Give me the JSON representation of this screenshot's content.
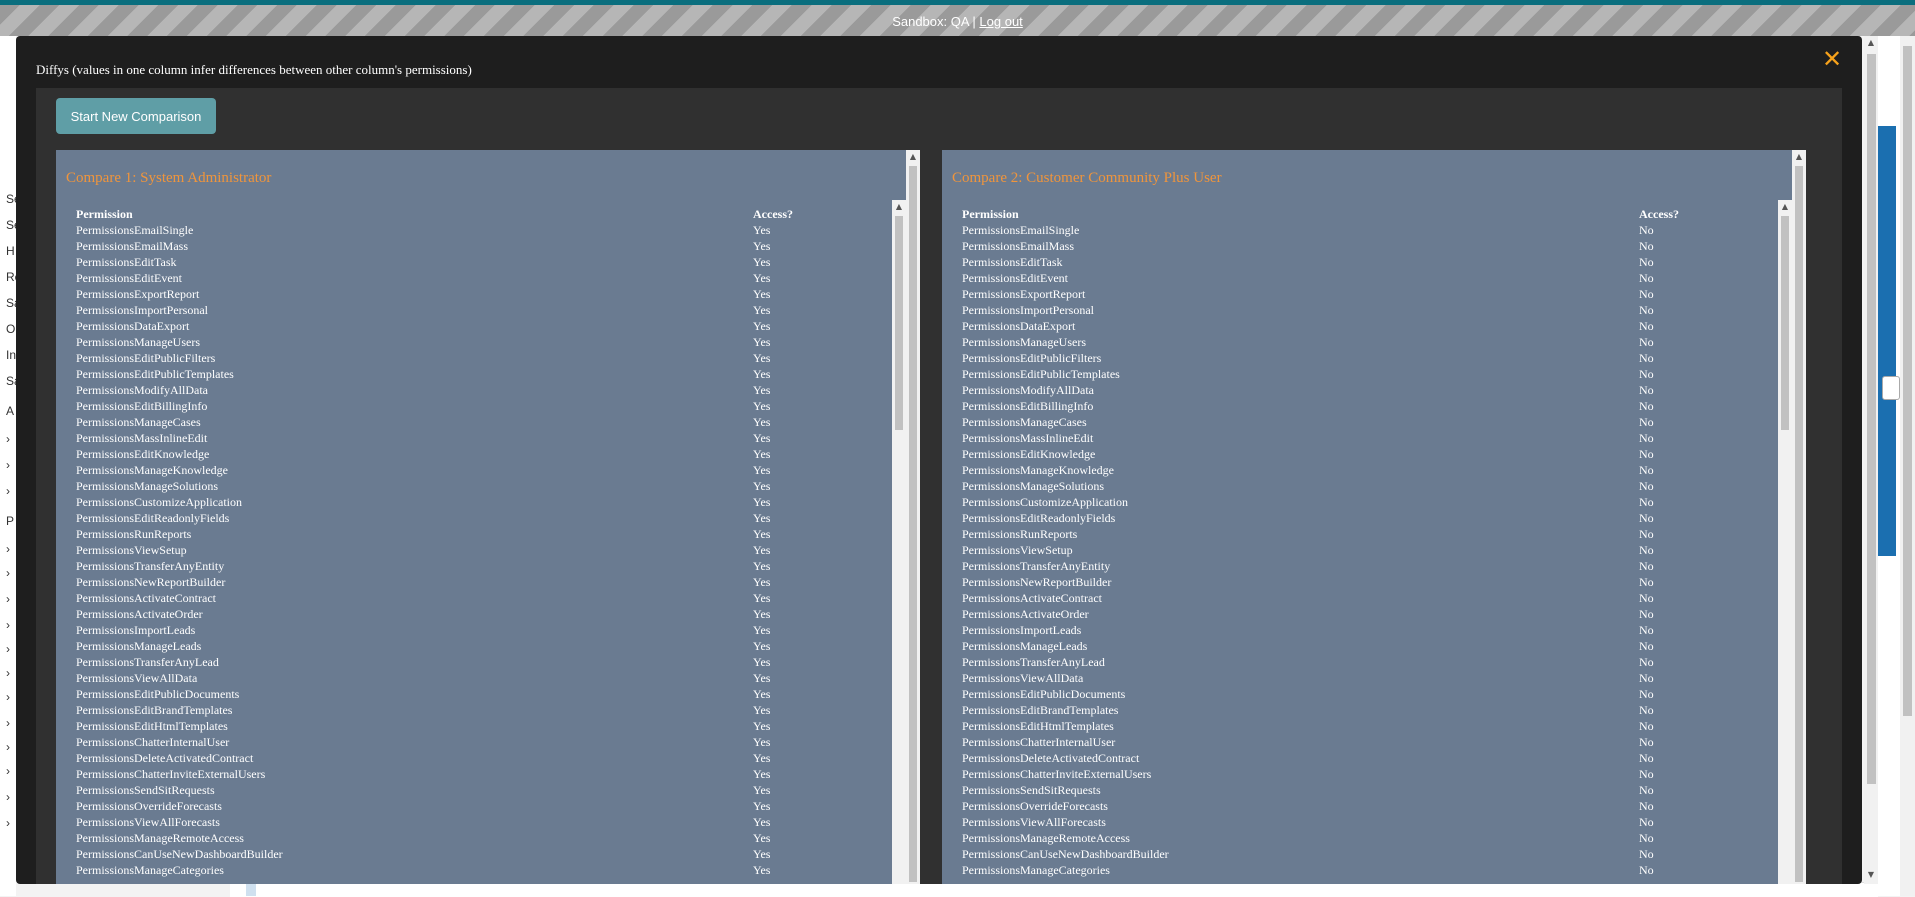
{
  "sandbox": {
    "label": "Sandbox: QA |",
    "logout": "Log out"
  },
  "background": {
    "side_letters": [
      "Se",
      "Se",
      "H",
      "Re",
      "Sa",
      "O",
      "In",
      "Sa",
      "A",
      "",
      "",
      "",
      "P",
      "",
      "",
      "",
      "",
      "",
      "",
      "",
      "",
      "",
      "",
      "",
      ""
    ]
  },
  "modal": {
    "title": "Diffys (values in one column infer differences between other column's permissions)",
    "close_glyph": "✕",
    "start_button": "Start New Comparison"
  },
  "compare1": {
    "title": "Compare 1: System Administrator",
    "col_permission": "Permission",
    "col_access": "Access?",
    "rows": [
      [
        "PermissionsEmailSingle",
        "Yes"
      ],
      [
        "PermissionsEmailMass",
        "Yes"
      ],
      [
        "PermissionsEditTask",
        "Yes"
      ],
      [
        "PermissionsEditEvent",
        "Yes"
      ],
      [
        "PermissionsExportReport",
        "Yes"
      ],
      [
        "PermissionsImportPersonal",
        "Yes"
      ],
      [
        "PermissionsDataExport",
        "Yes"
      ],
      [
        "PermissionsManageUsers",
        "Yes"
      ],
      [
        "PermissionsEditPublicFilters",
        "Yes"
      ],
      [
        "PermissionsEditPublicTemplates",
        "Yes"
      ],
      [
        "PermissionsModifyAllData",
        "Yes"
      ],
      [
        "PermissionsEditBillingInfo",
        "Yes"
      ],
      [
        "PermissionsManageCases",
        "Yes"
      ],
      [
        "PermissionsMassInlineEdit",
        "Yes"
      ],
      [
        "PermissionsEditKnowledge",
        "Yes"
      ],
      [
        "PermissionsManageKnowledge",
        "Yes"
      ],
      [
        "PermissionsManageSolutions",
        "Yes"
      ],
      [
        "PermissionsCustomizeApplication",
        "Yes"
      ],
      [
        "PermissionsEditReadonlyFields",
        "Yes"
      ],
      [
        "PermissionsRunReports",
        "Yes"
      ],
      [
        "PermissionsViewSetup",
        "Yes"
      ],
      [
        "PermissionsTransferAnyEntity",
        "Yes"
      ],
      [
        "PermissionsNewReportBuilder",
        "Yes"
      ],
      [
        "PermissionsActivateContract",
        "Yes"
      ],
      [
        "PermissionsActivateOrder",
        "Yes"
      ],
      [
        "PermissionsImportLeads",
        "Yes"
      ],
      [
        "PermissionsManageLeads",
        "Yes"
      ],
      [
        "PermissionsTransferAnyLead",
        "Yes"
      ],
      [
        "PermissionsViewAllData",
        "Yes"
      ],
      [
        "PermissionsEditPublicDocuments",
        "Yes"
      ],
      [
        "PermissionsEditBrandTemplates",
        "Yes"
      ],
      [
        "PermissionsEditHtmlTemplates",
        "Yes"
      ],
      [
        "PermissionsChatterInternalUser",
        "Yes"
      ],
      [
        "PermissionsDeleteActivatedContract",
        "Yes"
      ],
      [
        "PermissionsChatterInviteExternalUsers",
        "Yes"
      ],
      [
        "PermissionsSendSitRequests",
        "Yes"
      ],
      [
        "PermissionsOverrideForecasts",
        "Yes"
      ],
      [
        "PermissionsViewAllForecasts",
        "Yes"
      ],
      [
        "PermissionsManageRemoteAccess",
        "Yes"
      ],
      [
        "PermissionsCanUseNewDashboardBuilder",
        "Yes"
      ],
      [
        "PermissionsManageCategories",
        "Yes"
      ]
    ]
  },
  "compare2": {
    "title": "Compare 2: Customer Community Plus User",
    "col_permission": "Permission",
    "col_access": "Access?",
    "rows": [
      [
        "PermissionsEmailSingle",
        "No"
      ],
      [
        "PermissionsEmailMass",
        "No"
      ],
      [
        "PermissionsEditTask",
        "No"
      ],
      [
        "PermissionsEditEvent",
        "No"
      ],
      [
        "PermissionsExportReport",
        "No"
      ],
      [
        "PermissionsImportPersonal",
        "No"
      ],
      [
        "PermissionsDataExport",
        "No"
      ],
      [
        "PermissionsManageUsers",
        "No"
      ],
      [
        "PermissionsEditPublicFilters",
        "No"
      ],
      [
        "PermissionsEditPublicTemplates",
        "No"
      ],
      [
        "PermissionsModifyAllData",
        "No"
      ],
      [
        "PermissionsEditBillingInfo",
        "No"
      ],
      [
        "PermissionsManageCases",
        "No"
      ],
      [
        "PermissionsMassInlineEdit",
        "No"
      ],
      [
        "PermissionsEditKnowledge",
        "No"
      ],
      [
        "PermissionsManageKnowledge",
        "No"
      ],
      [
        "PermissionsManageSolutions",
        "No"
      ],
      [
        "PermissionsCustomizeApplication",
        "No"
      ],
      [
        "PermissionsEditReadonlyFields",
        "No"
      ],
      [
        "PermissionsRunReports",
        "No"
      ],
      [
        "PermissionsViewSetup",
        "No"
      ],
      [
        "PermissionsTransferAnyEntity",
        "No"
      ],
      [
        "PermissionsNewReportBuilder",
        "No"
      ],
      [
        "PermissionsActivateContract",
        "No"
      ],
      [
        "PermissionsActivateOrder",
        "No"
      ],
      [
        "PermissionsImportLeads",
        "No"
      ],
      [
        "PermissionsManageLeads",
        "No"
      ],
      [
        "PermissionsTransferAnyLead",
        "No"
      ],
      [
        "PermissionsViewAllData",
        "No"
      ],
      [
        "PermissionsEditPublicDocuments",
        "No"
      ],
      [
        "PermissionsEditBrandTemplates",
        "No"
      ],
      [
        "PermissionsEditHtmlTemplates",
        "No"
      ],
      [
        "PermissionsChatterInternalUser",
        "No"
      ],
      [
        "PermissionsDeleteActivatedContract",
        "No"
      ],
      [
        "PermissionsChatterInviteExternalUsers",
        "No"
      ],
      [
        "PermissionsSendSitRequests",
        "No"
      ],
      [
        "PermissionsOverrideForecasts",
        "No"
      ],
      [
        "PermissionsViewAllForecasts",
        "No"
      ],
      [
        "PermissionsManageRemoteAccess",
        "No"
      ],
      [
        "PermissionsCanUseNewDashboardBuilder",
        "No"
      ],
      [
        "PermissionsManageCategories",
        "No"
      ]
    ]
  },
  "colors": {
    "title_orange": "#f0953c",
    "panel_bg": "#6a7b91",
    "button_teal": "#5f9ea6",
    "close_orange": "#f7a21b"
  }
}
